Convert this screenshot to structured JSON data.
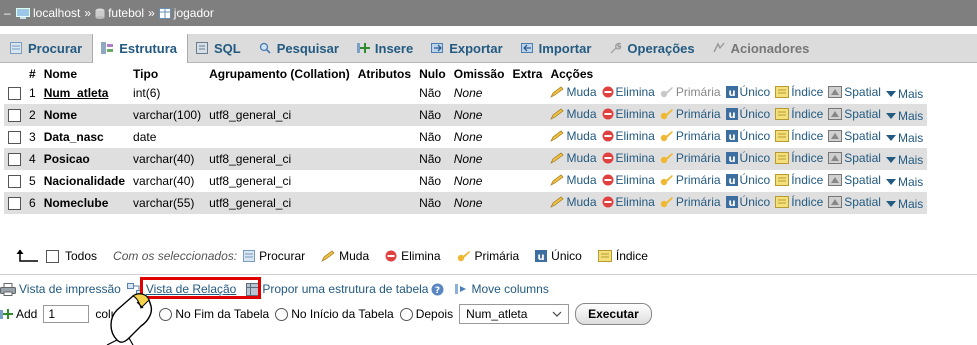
{
  "breadcrumb": {
    "server": "localhost",
    "database": "futebol",
    "table": "jogador",
    "separator": "»"
  },
  "tabs": [
    {
      "label": "Procurar",
      "icon": "browse-icon"
    },
    {
      "label": "Estrutura",
      "icon": "structure-icon",
      "active": true
    },
    {
      "label": "SQL",
      "icon": "sql-icon"
    },
    {
      "label": "Pesquisar",
      "icon": "search-icon"
    },
    {
      "label": "Insere",
      "icon": "insert-icon"
    },
    {
      "label": "Exportar",
      "icon": "export-icon"
    },
    {
      "label": "Importar",
      "icon": "import-icon"
    },
    {
      "label": "Operações",
      "icon": "wrench-icon"
    },
    {
      "label": "Acionadores",
      "icon": "triggers-icon",
      "disabled": true
    }
  ],
  "columns": {
    "num": "#",
    "name": "Nome",
    "type": "Tipo",
    "collation": "Agrupamento (Collation)",
    "attributes": "Atributos",
    "null": "Nulo",
    "default": "Omissão",
    "extra": "Extra",
    "actions": "Acções"
  },
  "rows": [
    {
      "num": "1",
      "name": "Num_atleta",
      "type": "int(6)",
      "collation": "",
      "null": "Não",
      "default": "None",
      "primary": true
    },
    {
      "num": "2",
      "name": "Nome",
      "type": "varchar(100)",
      "collation": "utf8_general_ci",
      "null": "Não",
      "default": "None"
    },
    {
      "num": "3",
      "name": "Data_nasc",
      "type": "date",
      "collation": "",
      "null": "Não",
      "default": "None"
    },
    {
      "num": "4",
      "name": "Posicao",
      "type": "varchar(40)",
      "collation": "utf8_general_ci",
      "null": "Não",
      "default": "None"
    },
    {
      "num": "5",
      "name": "Nacionalidade",
      "type": "varchar(40)",
      "collation": "utf8_general_ci",
      "null": "Não",
      "default": "None"
    },
    {
      "num": "6",
      "name": "Nomeclube",
      "type": "varchar(55)",
      "collation": "utf8_general_ci",
      "null": "Não",
      "default": "None"
    }
  ],
  "row_actions": {
    "change": "Muda",
    "drop": "Elimina",
    "primary": "Primária",
    "unique": "Único",
    "index": "Índice",
    "spatial": "Spatial",
    "more": "Mais"
  },
  "with_selected": {
    "check_all": "Todos",
    "label": "Com os seleccionados:",
    "browse": "Procurar",
    "change": "Muda",
    "drop": "Elimina",
    "primary": "Primária",
    "unique": "Único",
    "index": "Índice"
  },
  "links": {
    "print": "Vista de impressão",
    "relation": "Vista de Relação",
    "propose": "Propor uma estrutura de tabela",
    "move": "Move columns"
  },
  "add": {
    "label": "Add",
    "value": "1",
    "columns_word": "colu",
    "end": "No Fim da Tabela",
    "start": "No Início da Tabela",
    "after": "Depois",
    "after_field": "Num_atleta",
    "execute": "Executar"
  },
  "colors": {
    "link": "#235a81",
    "breadcrumb_bg": "#7f7f7f",
    "tabs_bg": "#dcdcdc",
    "highlight": "#e00000"
  }
}
